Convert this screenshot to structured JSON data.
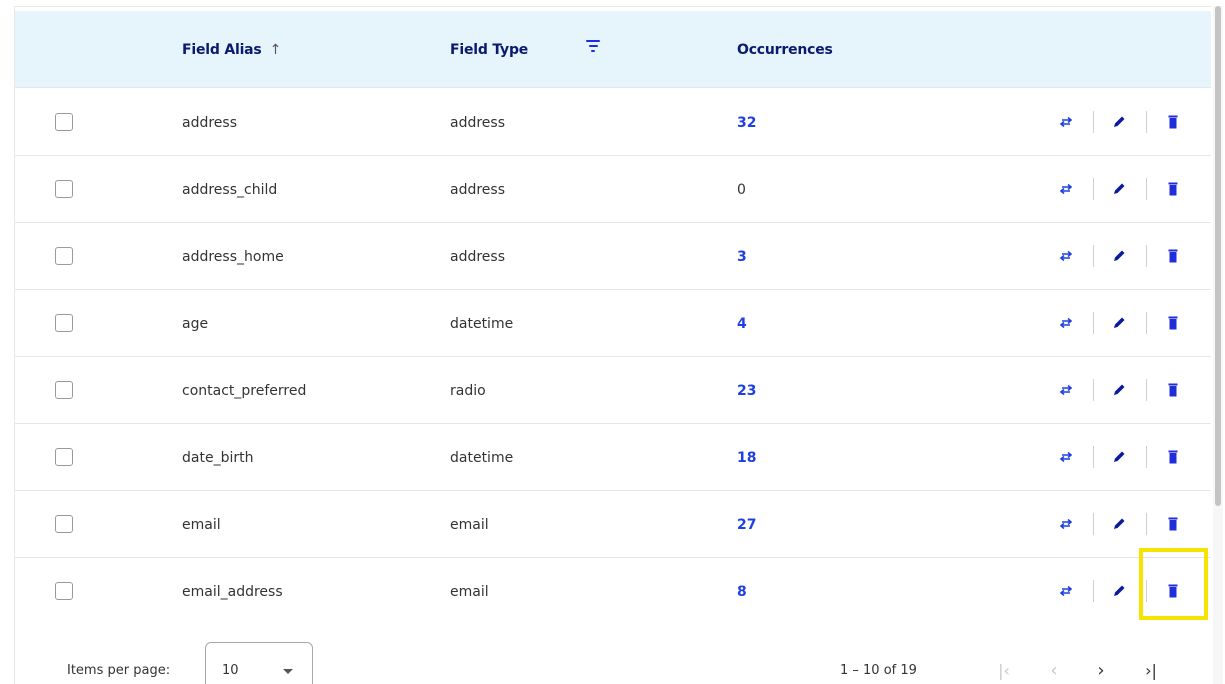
{
  "table": {
    "columns": {
      "alias": "Field Alias",
      "type": "Field Type",
      "occurrences": "Occurrences"
    },
    "sort_icon": "arrow-up-icon",
    "filter_icon": "filter-icon",
    "rows": [
      {
        "alias": "address",
        "type": "address",
        "occurrences": "32"
      },
      {
        "alias": "address_child",
        "type": "address",
        "occurrences": "0"
      },
      {
        "alias": "address_home",
        "type": "address",
        "occurrences": "3"
      },
      {
        "alias": "age",
        "type": "datetime",
        "occurrences": "4"
      },
      {
        "alias": "contact_preferred",
        "type": "radio",
        "occurrences": "23"
      },
      {
        "alias": "date_birth",
        "type": "datetime",
        "occurrences": "18"
      },
      {
        "alias": "email",
        "type": "email",
        "occurrences": "27"
      },
      {
        "alias": "email_address",
        "type": "email",
        "occurrences": "8"
      }
    ],
    "row_actions": [
      "swap-icon",
      "edit-pencil-icon",
      "delete-trash-icon"
    ]
  },
  "paginator": {
    "items_per_page_label": "Items per page:",
    "items_per_page_value": "10",
    "range_label": "1 – 10 of 19",
    "buttons": [
      "first-page-icon",
      "previous-page-icon",
      "next-page-icon",
      "last-page-icon"
    ]
  },
  "colors": {
    "header_bg": "#e6f5fc",
    "header_text": "#0a1a6e",
    "accent": "#1f3fe0",
    "highlight": "#f6e400"
  }
}
